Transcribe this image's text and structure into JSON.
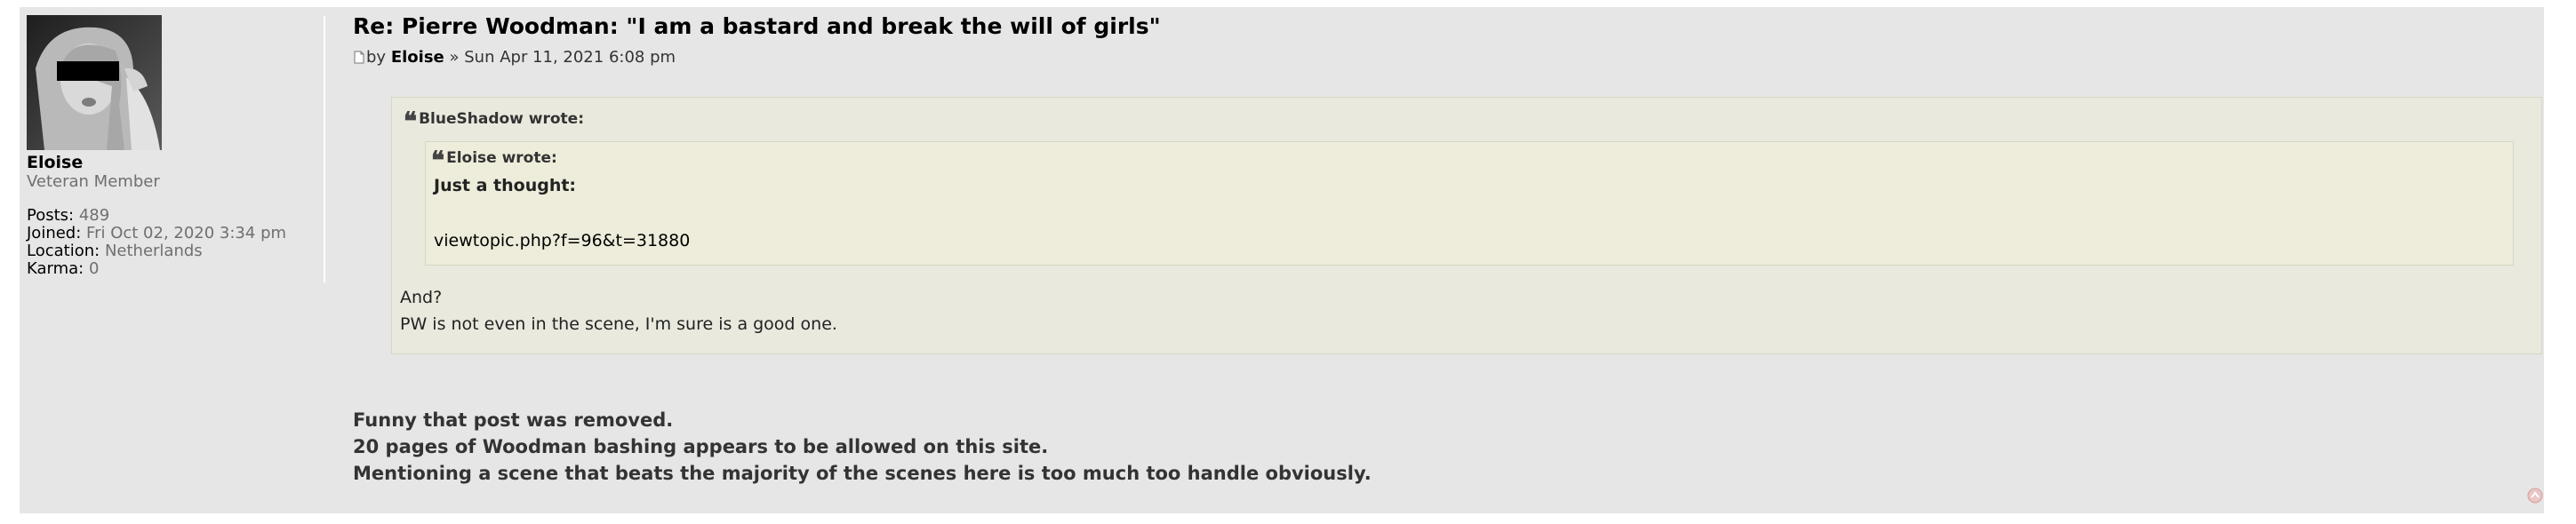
{
  "profile": {
    "username": "Eloise",
    "rank": "Veteran Member",
    "stats": [
      {
        "key": "Posts:",
        "value": "489"
      },
      {
        "key": "Joined:",
        "value": "Fri Oct 02, 2020 3:34 pm"
      },
      {
        "key": "Location:",
        "value": "Netherlands"
      },
      {
        "key": "Karma:",
        "value": "0"
      }
    ]
  },
  "post": {
    "title": "Re: Pierre Woodman: \"I am a bastard and break the will of girls\"",
    "by_word": "by",
    "author": "Eloise",
    "separator": "»",
    "date": "Sun Apr 11, 2021 6:08 pm",
    "outer_quote": {
      "cite": "BlueShadow wrote:",
      "inner_quote": {
        "cite": "Eloise wrote:",
        "line1": "Just a thought:",
        "link": "viewtopic.php?f=96&t=31880"
      },
      "line1": "And?",
      "line2": "PW is not even in the scene, I'm sure is a good one."
    },
    "body": [
      "Funny that post was removed.",
      "20 pages of Woodman bashing appears to be allowed on this site.",
      "Mentioning a scene that beats the majority of the scenes here is too much too handle obviously."
    ]
  },
  "icons": {
    "post": "post-icon",
    "quote": "quote-icon",
    "back_to_top": "back-to-top-icon"
  },
  "colors": {
    "post_bg": "#e6e6e6",
    "quote_bg": "#e9e9de",
    "inner_quote_bg": "#eeeddb",
    "muted_text": "#6f6f6f"
  }
}
